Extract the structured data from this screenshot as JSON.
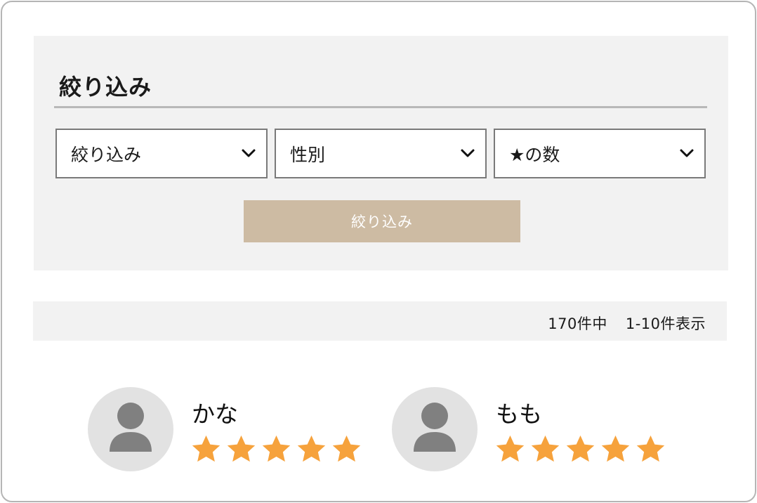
{
  "filter": {
    "title": "絞り込み",
    "selects": [
      {
        "label": "絞り込み",
        "icon": "chevron-down-icon"
      },
      {
        "label": "性別",
        "icon": "chevron-down-icon"
      },
      {
        "label": "★の数",
        "icon": "chevron-down-icon"
      }
    ],
    "submit_label": "絞り込み"
  },
  "results": {
    "total": "170件中",
    "range": "1-10件表示"
  },
  "reviewers": [
    {
      "name": "かな",
      "rating": 5,
      "max_rating": 5,
      "avatar_icon": "user-icon"
    },
    {
      "name": "もも",
      "rating": 5,
      "max_rating": 5,
      "avatar_icon": "user-icon"
    }
  ],
  "colors": {
    "panel_bg": "#f2f2f2",
    "button_bg": "#cdbba3",
    "star": "#f6a23c",
    "avatar_bg": "#e2e2e2",
    "avatar_fg": "#808080"
  }
}
